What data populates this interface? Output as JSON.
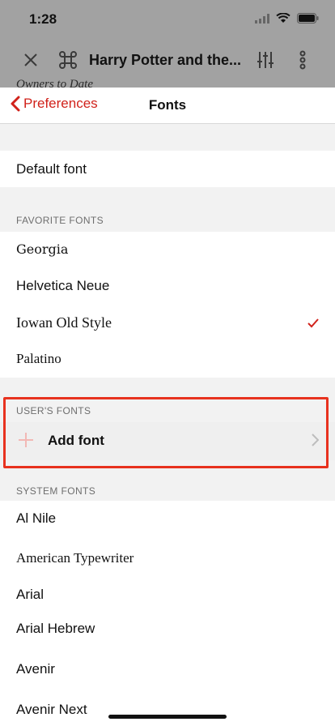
{
  "status": {
    "time": "1:28"
  },
  "toolbar": {
    "title": "Harry Potter and the..."
  },
  "background_text": "Owners to Date",
  "nav": {
    "back_label": "Preferences",
    "title": "Fonts"
  },
  "default_font_label": "Default font",
  "favorites": {
    "header": "FAVORITE FONTS",
    "items": [
      "Georgia",
      "Helvetica Neue",
      "Iowan Old Style",
      "Palatino"
    ],
    "selected": "Iowan Old Style"
  },
  "user_fonts": {
    "header": "USER'S FONTS",
    "add_label": "Add font"
  },
  "system_fonts": {
    "header": "SYSTEM FONTS",
    "items": [
      "Al Nile",
      "American Typewriter",
      "Arial",
      "Arial Hebrew",
      "Avenir",
      "Avenir Next"
    ]
  },
  "colors": {
    "accent": "#d1221b",
    "highlight": "#e8321f"
  }
}
